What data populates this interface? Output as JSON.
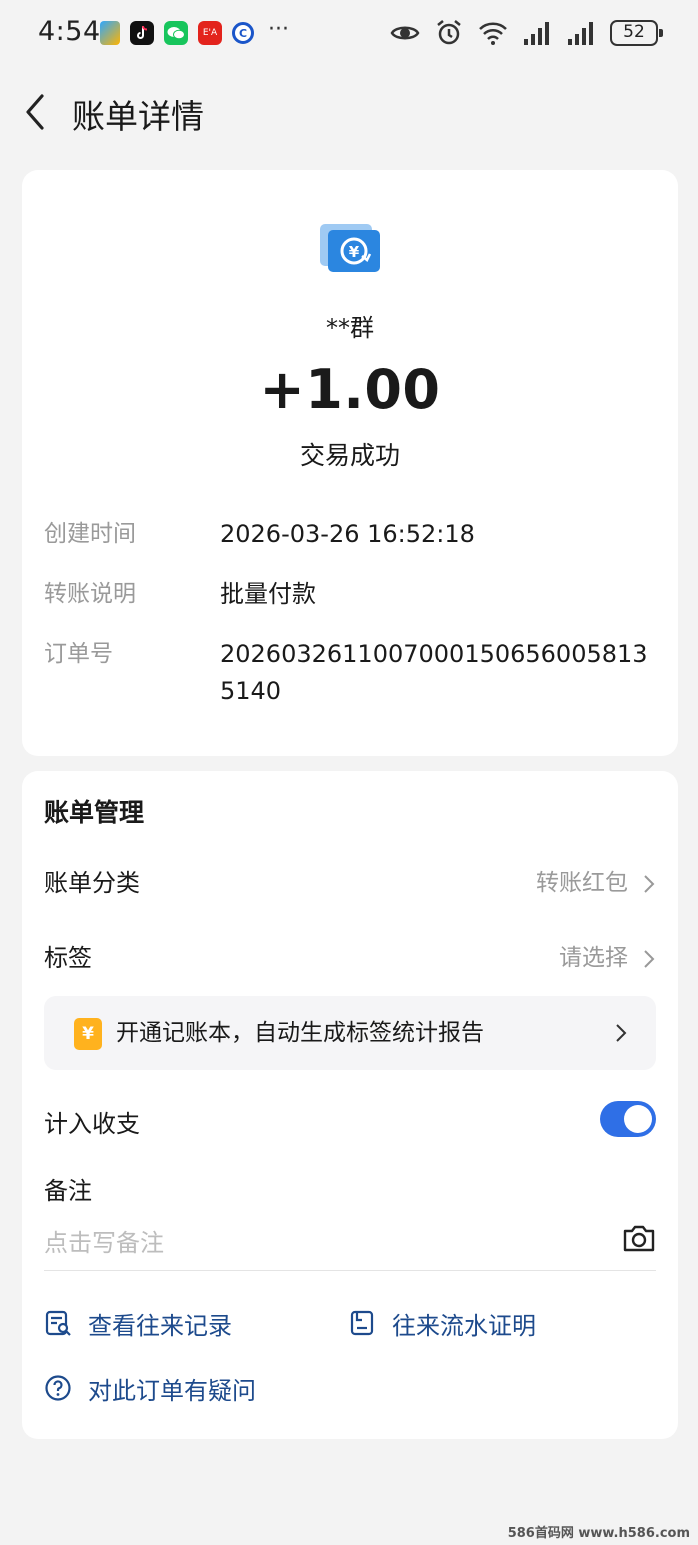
{
  "status_bar": {
    "time": "4:54",
    "more": "···",
    "battery": "52",
    "red_app_text": "E'A"
  },
  "header": {
    "title": "账单详情"
  },
  "transaction": {
    "payer": "**群",
    "amount": "+1.00",
    "status": "交易成功",
    "details": [
      {
        "label": "创建时间",
        "value": "2026-03-26 16:52:18"
      },
      {
        "label": "转账说明",
        "value": "批量付款"
      },
      {
        "label": "订单号",
        "value": "20260326110070001506560058135140"
      }
    ],
    "icon_color": "#2b86e0"
  },
  "management": {
    "title": "账单管理",
    "category_label": "账单分类",
    "category_value": "转账红包",
    "tag_label": "标签",
    "tag_value": "请选择",
    "promo_icon": "¥",
    "promo_text": "开通记账本，自动生成标签统计报告",
    "include_label": "计入收支",
    "include_enabled": true,
    "note_label": "备注",
    "note_placeholder": "点击写备注",
    "links": {
      "history": "查看往来记录",
      "proof": "往来流水证明",
      "question": "对此订单有疑问"
    },
    "accent_color": "#2f6fe6",
    "link_color": "#1d4a8c"
  },
  "watermark": "586首码网 www.h586.com"
}
